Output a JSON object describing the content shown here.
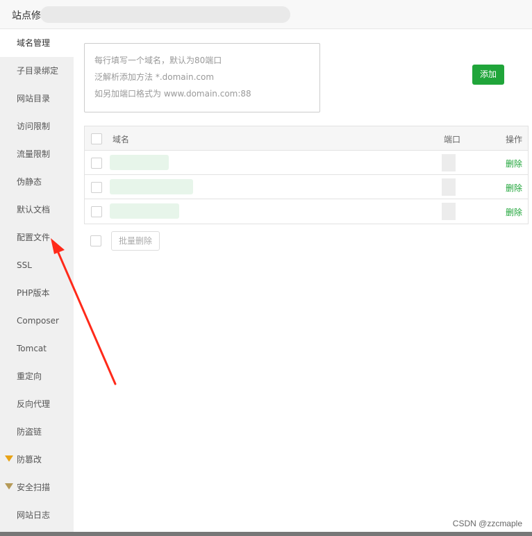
{
  "window": {
    "title": "站点修"
  },
  "sidebar": {
    "items": [
      {
        "label": "域名管理"
      },
      {
        "label": "子目录绑定"
      },
      {
        "label": "网站目录"
      },
      {
        "label": "访问限制"
      },
      {
        "label": "流量限制"
      },
      {
        "label": "伪静态"
      },
      {
        "label": "默认文档"
      },
      {
        "label": "配置文件"
      },
      {
        "label": "SSL"
      },
      {
        "label": "PHP版本"
      },
      {
        "label": "Composer"
      },
      {
        "label": "Tomcat"
      },
      {
        "label": "重定向"
      },
      {
        "label": "反向代理"
      },
      {
        "label": "防盗链"
      },
      {
        "label": "防篡改",
        "icon": "gem-icon"
      },
      {
        "label": "安全扫描",
        "icon": "gem-icon"
      },
      {
        "label": "网站日志"
      }
    ]
  },
  "domain_input": {
    "line1": "每行填写一个域名，默认为80端口",
    "line2": "泛解析添加方法 *.domain.com",
    "line3": "如另加端口格式为 www.domain.com:88"
  },
  "add_button": {
    "label": "添加"
  },
  "table": {
    "headers": {
      "domain": "域名",
      "port": "端口",
      "action": "操作"
    },
    "rows": [
      {
        "action": "删除"
      },
      {
        "action": "删除"
      },
      {
        "action": "删除"
      }
    ]
  },
  "bulk_delete": {
    "label": "批量删除"
  },
  "watermark": "CSDN @zzcmaple",
  "colors": {
    "accent": "#20a53a",
    "arrow": "#ff2a1a",
    "sidebar_bg": "#f0f0f0"
  }
}
